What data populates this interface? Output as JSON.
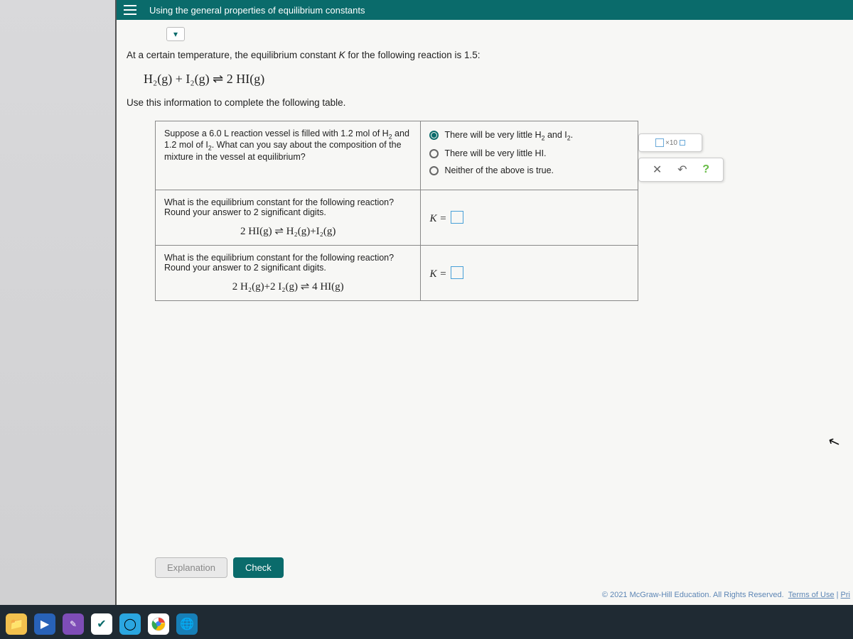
{
  "header": {
    "title": "Using the general properties of equilibrium constants"
  },
  "problem": {
    "intro_a": "At a certain temperature, the equilibrium constant ",
    "intro_b": " for the following reaction is ",
    "k_value": "1.5",
    "equation": "H₂(g) + I₂(g) ⇌ 2 HI(g)",
    "instruction": "Use this information to complete the following table."
  },
  "rows": [
    {
      "prompt_a": "Suppose a 6.0 L reaction vessel is filled with 1.2 mol of H",
      "prompt_b": " and 1.2 mol of I",
      "prompt_c": ". What can you say about the composition of the mixture in the vessel at equilibrium?",
      "options": [
        {
          "label_a": "There will be very little H",
          "label_b": " and I",
          "label_c": ".",
          "selected": true
        },
        {
          "label": "There will be very little HI.",
          "selected": false
        },
        {
          "label": "Neither of the above is true.",
          "selected": false
        }
      ]
    },
    {
      "prompt": "What is the equilibrium constant for the following reaction? Round your answer to 2 significant digits.",
      "equation": "2 HI(g)   ⇌   H₂(g)+I₂(g)",
      "answer_label": "K ="
    },
    {
      "prompt": "What is the equilibrium constant for the following reaction? Round your answer to 2 significant digits.",
      "equation": "2 H₂(g)+2 I₂(g)   ⇌   4 HI(g)",
      "answer_label": "K ="
    }
  ],
  "tools": {
    "sci_label": "×10",
    "close": "✕",
    "undo": "↶",
    "help": "?"
  },
  "buttons": {
    "explanation": "Explanation",
    "check": "Check"
  },
  "footer": {
    "copyright": "© 2021 McGraw-Hill Education. All Rights Reserved.",
    "link1": "Terms of Use",
    "sep": " | ",
    "link2": "Pri"
  }
}
